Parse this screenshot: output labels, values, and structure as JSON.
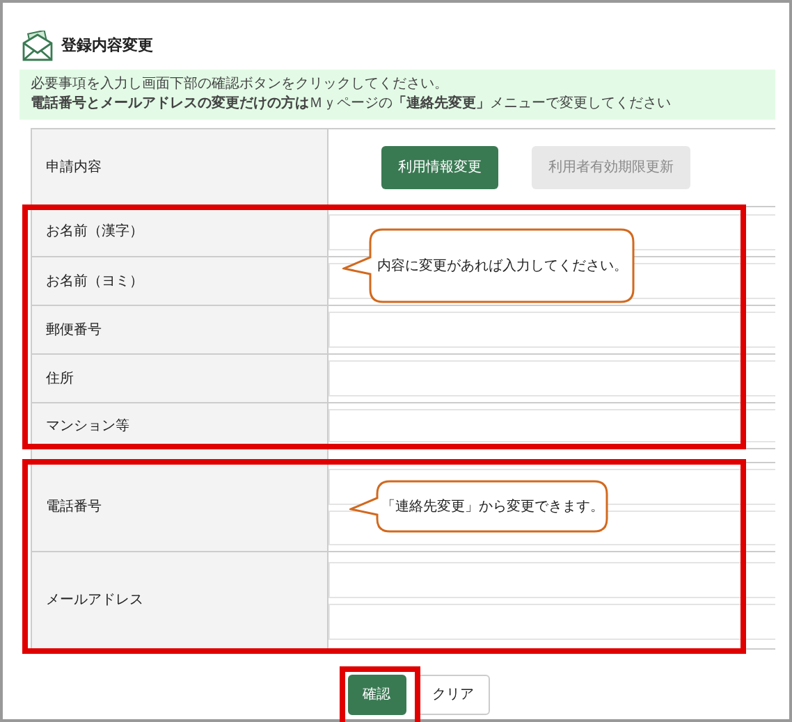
{
  "page": {
    "title": "登録内容変更"
  },
  "notice": {
    "line_1": "必要事項を入力し画面下部の確認ボタンをクリックしてください。",
    "line_2": "**電話番号とメールアドレスの変更だけの方は**Ｍｙページの",
    "link": "「連絡先変更」",
    "line_2_end": "メニューで変更してください"
  },
  "application": {
    "label": "申請内容",
    "options": [
      {
        "label": "利用情報変更",
        "disabled": false
      },
      {
        "label": "利用者有効期限更新",
        "disabled": true
      }
    ]
  },
  "group_1": {
    "rows": [
      {
        "label": "お名前（漢字）",
        "kind": "single"
      },
      {
        "label": "お名前（ヨミ）",
        "kind": "single"
      },
      {
        "label": "郵便番号",
        "kind": "single"
      },
      {
        "label": "住所",
        "kind": "single"
      },
      {
        "label": "マンション等",
        "kind": "single"
      }
    ],
    "callout": "内容に変更があれば入力してください。"
  },
  "group_2": {
    "rows": [
      {
        "label": "電話番号",
        "kind": "double"
      },
      {
        "label": "メールアドレス",
        "kind": "double"
      }
    ],
    "callout": "「連絡先変更」から変更できます。"
  },
  "buttons": [
    {
      "label": "確認",
      "kind": "primary",
      "highlighted": true
    },
    {
      "label": "クリア",
      "kind": "secondary",
      "highlighted": false
    }
  ]
}
